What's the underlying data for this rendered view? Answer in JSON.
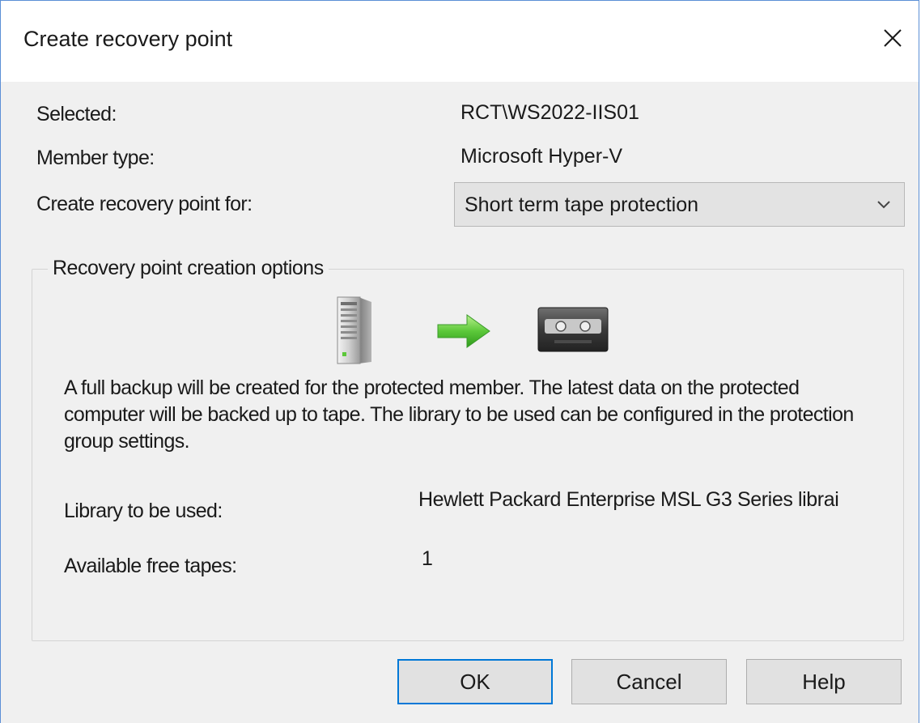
{
  "window": {
    "title": "Create recovery point"
  },
  "fields": {
    "selected_label": "Selected:",
    "selected_value": "RCT\\WS2022-IIS01",
    "member_type_label": "Member type:",
    "member_type_value": "Microsoft Hyper-V",
    "create_for_label": "Create recovery point for:",
    "create_for_value": "Short term tape protection"
  },
  "options": {
    "legend": "Recovery point creation options",
    "description": "A full backup will be created for the protected member. The latest data on the protected computer will be backed up to tape. The library to be used can be configured in the protection group settings.",
    "library_label": "Library to be used:",
    "library_value": "Hewlett Packard Enterprise MSL G3 Series librai",
    "free_tapes_label": "Available free tapes:",
    "free_tapes_value": "1"
  },
  "icons": {
    "close": "close-icon",
    "dropdown": "chevron-down-icon",
    "server": "server-icon",
    "arrow": "arrow-right-icon",
    "tape": "tape-cassette-icon"
  },
  "colors": {
    "accent": "#0078d7",
    "arrow_green": "#5cc83a",
    "window_border": "#5b8fd6"
  },
  "buttons": {
    "ok": "OK",
    "cancel": "Cancel",
    "help": "Help"
  }
}
